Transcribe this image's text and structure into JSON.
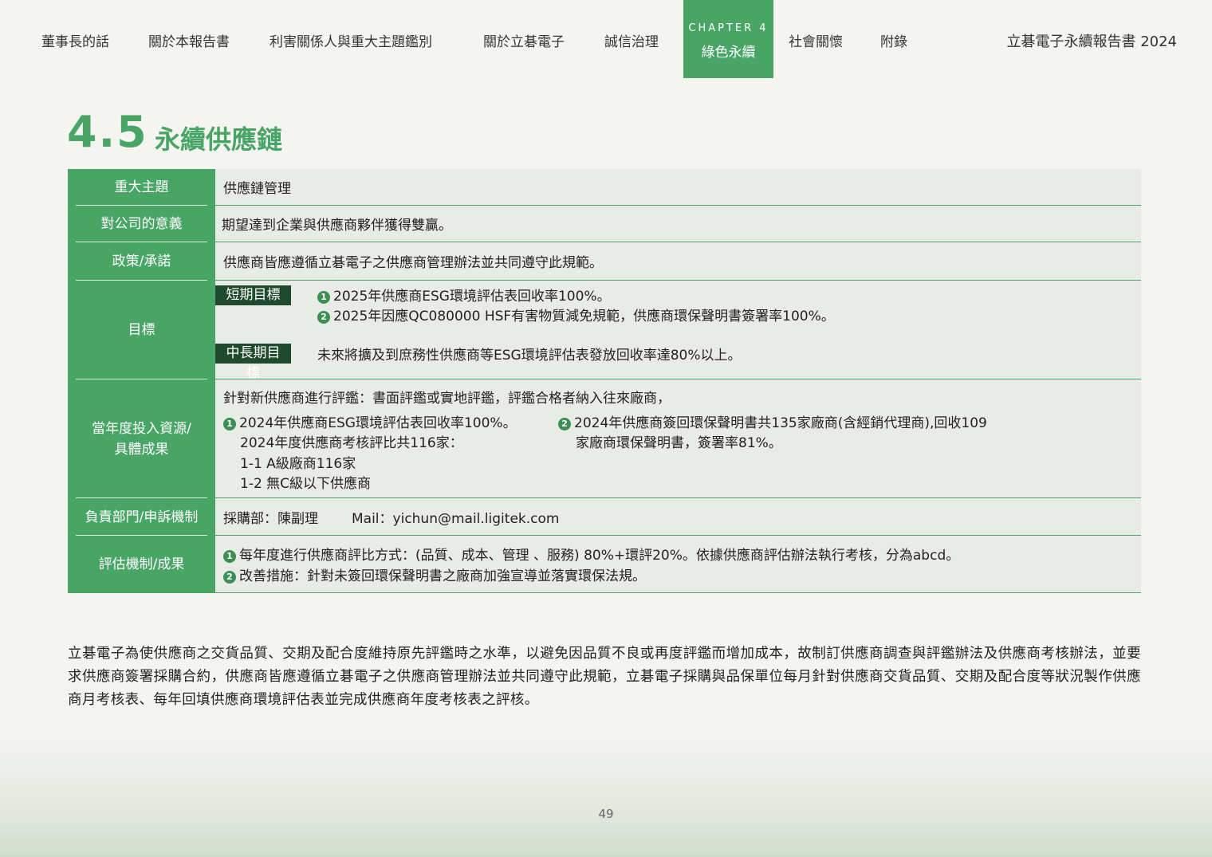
{
  "nav": {
    "items": [
      "董事長的話",
      "關於本報告書",
      "利害關係人與重大主題鑑別",
      "關於立碁電子",
      "誠信治理",
      "綠色永續",
      "社會關懷",
      "附錄"
    ],
    "active_chapter": "CHAPTER 4",
    "active_label": "綠色永續",
    "report_title": "立碁電子永續報告書 2024"
  },
  "section": {
    "number": "4.5",
    "title": "永續供應鏈"
  },
  "table": {
    "topic_label": "重大主題",
    "topic_value": "供應鏈管理",
    "meaning_label": "對公司的意義",
    "meaning_value": "期望達到企業與供應商夥伴獲得雙贏。",
    "policy_label": "政策/承諾",
    "policy_value": "供應商皆應遵循立碁電子之供應商管理辦法並共同遵守此規範。",
    "goal_label": "目標",
    "short_tag": "短期目標",
    "short_1": "2025年供應商ESG環境評估表回收率100%。",
    "short_2": "2025年因應QC080000 HSF有害物質減免規範，供應商環保聲明書簽署率100%。",
    "mid_tag": "中長期目標",
    "mid_1": "未來將擴及到庶務性供應商等ESG環境評估表發放回收率達80%以上。",
    "res_label_1": "當年度投入資源/",
    "res_label_2": "具體成果",
    "res_intro": "針對新供應商進行評鑑：書面評鑑或實地評鑑，評鑑合格者納入往來廠商，",
    "res_a1": "2024年供應商ESG環境評估表回收率100%。",
    "res_a2": "2024年度供應商考核評比共116家：",
    "res_a3": "1-1 A級廠商116家",
    "res_a4": "1-2 無C級以下供應商",
    "res_b1": "2024年供應商簽回環保聲明書共135家廠商(含經銷代理商),回收109",
    "res_b2": "家廠商環保聲明書，簽署率81%。",
    "dept_label": "負責部門/申訴機制",
    "dept_value": "採購部：陳副理",
    "dept_mail": "Mail：yichun@mail.ligitek.com",
    "eval_label": "評估機制/成果",
    "eval_1": "每年度進行供應商評比方式：(品質、成本、管理 、服務) 80%+環評20%。依據供應商評估辦法執行考核，分為abcd。",
    "eval_2": "改善措施：針對未簽回環保聲明書之廠商加強宣導並落實環保法規。",
    "bullet_1": "1",
    "bullet_2": "2"
  },
  "paragraph": "立碁電子為使供應商之交貨品質、交期及配合度維持原先評鑑時之水準，以避免因品質不良或再度評鑑而增加成本，故制訂供應商調查與評鑑辦法及供應商考核辦法，並要求供應商簽署採購合約，供應商皆應遵循立碁電子之供應商管理辦法並共同遵守此規範，立碁電子採購與品保單位每月針對供應商交貨品質、交期及配合度等狀況製作供應商月考核表、每年回填供應商環境評估表並完成供應商年度考核表之評核。",
  "page_number": "49",
  "colors": {
    "accent": "#48a565",
    "dark_tag": "#1f4a2d",
    "cell_bg": "#e9ebe6"
  }
}
